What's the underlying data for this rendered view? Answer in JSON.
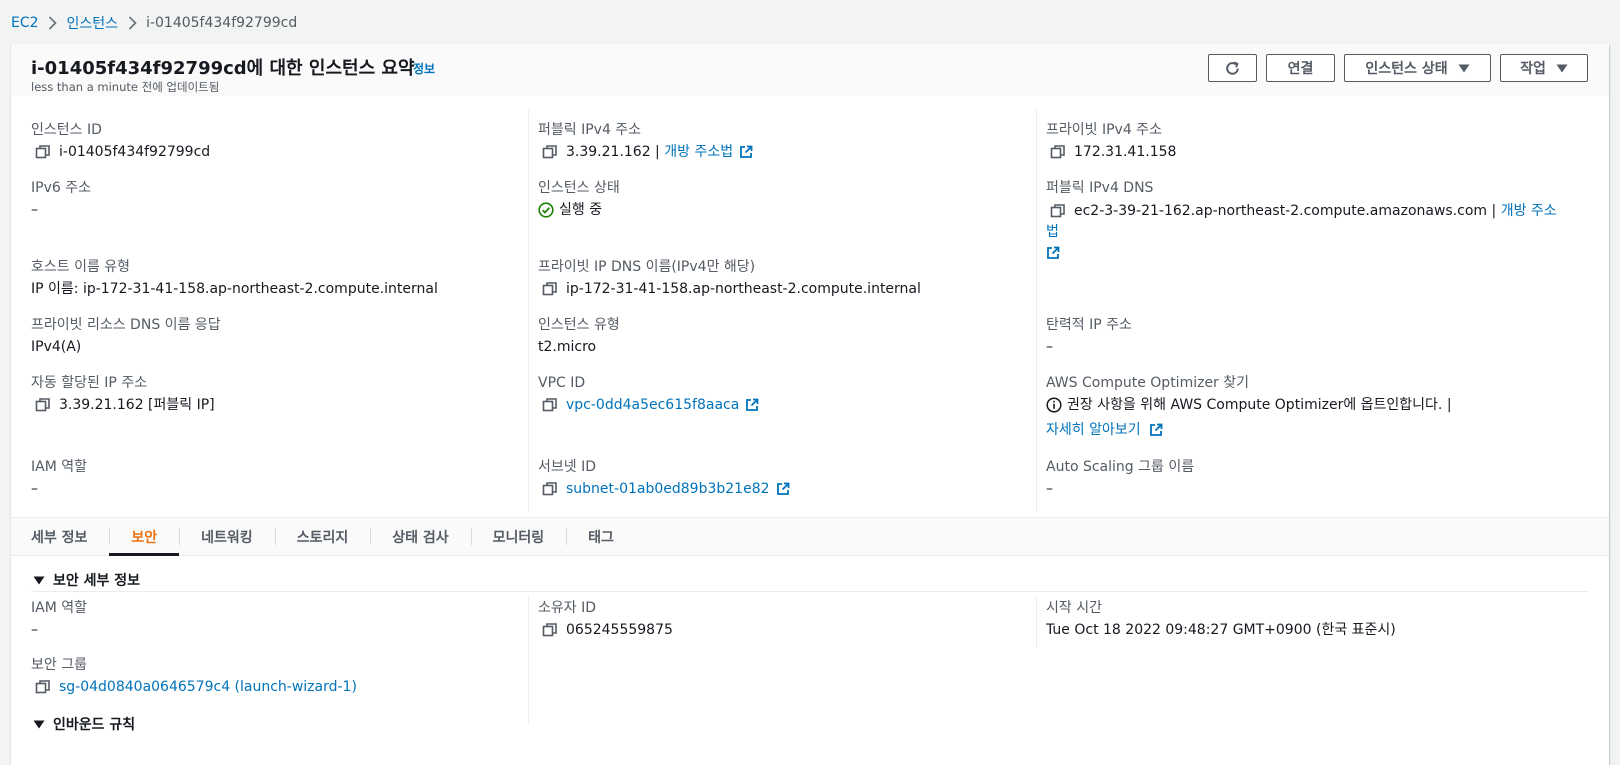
{
  "breadcrumb": {
    "items": [
      "EC2",
      "인스턴스",
      "i-01405f434f92799cd"
    ]
  },
  "header": {
    "title": "i-01405f434f92799cd에 대한 인스턴스 요약",
    "info": "정보",
    "subtitle": "less than a minute 전에 업데이트됨",
    "buttons": {
      "connect": "연결",
      "instance_state": "인스턴스 상태",
      "actions": "작업"
    }
  },
  "summary": {
    "instance_id": {
      "label": "인스턴스 ID",
      "value": "i-01405f434f92799cd"
    },
    "public_ipv4": {
      "label": "퍼블릭 IPv4 주소",
      "value": "3.39.21.162",
      "sep": " | ",
      "link": "개방 주소법"
    },
    "private_ipv4": {
      "label": "프라이빗 IPv4 주소",
      "value": "172.31.41.158"
    },
    "ipv6": {
      "label": "IPv6 주소",
      "value": "–"
    },
    "instance_state": {
      "label": "인스턴스 상태",
      "value": "실행 중"
    },
    "public_dns": {
      "label": "퍼블릭 IPv4 DNS",
      "value": "ec2-3-39-21-162.ap-northeast-2.compute.amazonaws.com",
      "sep": " | ",
      "link": "개방 주소법"
    },
    "hostname_type": {
      "label": "호스트 이름 유형",
      "value": "IP 이름: ip-172-31-41-158.ap-northeast-2.compute.internal"
    },
    "private_dns": {
      "label": "프라이빗 IP DNS 이름(IPv4만 해당)",
      "value": "ip-172-31-41-158.ap-northeast-2.compute.internal"
    },
    "resource_dns": {
      "label": "프라이빗 리소스 DNS 이름 응답",
      "value": "IPv4(A)"
    },
    "instance_type": {
      "label": "인스턴스 유형",
      "value": "t2.micro"
    },
    "elastic_ip": {
      "label": "탄력적 IP 주소",
      "value": "–"
    },
    "auto_ip": {
      "label": "자동 할당된 IP 주소",
      "value": "3.39.21.162 [퍼블릭 IP]"
    },
    "vpc_id": {
      "label": "VPC ID",
      "value": "vpc-0dd4a5ec615f8aaca"
    },
    "optimizer": {
      "label": "AWS Compute Optimizer 찾기",
      "value": "권장 사항을 위해 AWS Compute Optimizer에 옵트인합니다. |",
      "link": "자세히 알아보기"
    },
    "iam_role": {
      "label": "IAM 역할",
      "value": "–"
    },
    "subnet_id": {
      "label": "서브넷 ID",
      "value": "subnet-01ab0ed89b3b21e82"
    },
    "asg_name": {
      "label": "Auto Scaling 그룹 이름",
      "value": "–"
    }
  },
  "tabs": [
    "세부 정보",
    "보안",
    "네트워킹",
    "스토리지",
    "상태 검사",
    "모니터링",
    "태그"
  ],
  "active_tab": "보안",
  "security": {
    "section_title": "보안 세부 정보",
    "iam_role": {
      "label": "IAM 역할",
      "value": "–"
    },
    "owner_id": {
      "label": "소유자 ID",
      "value": "065245559875"
    },
    "launch_time": {
      "label": "시작 시간",
      "value": "Tue Oct 18 2022 09:48:27 GMT+0900 (한국 표준시)"
    },
    "security_group": {
      "label": "보안 그룹",
      "value": "sg-04d0840a0646579c4 (launch-wizard-1)"
    },
    "inbound_title": "인바운드 규칙"
  },
  "colors": {
    "link": "#0073bb",
    "success": "#1d8102",
    "active_tab": "#ec7211",
    "text_secondary": "#545b64"
  }
}
